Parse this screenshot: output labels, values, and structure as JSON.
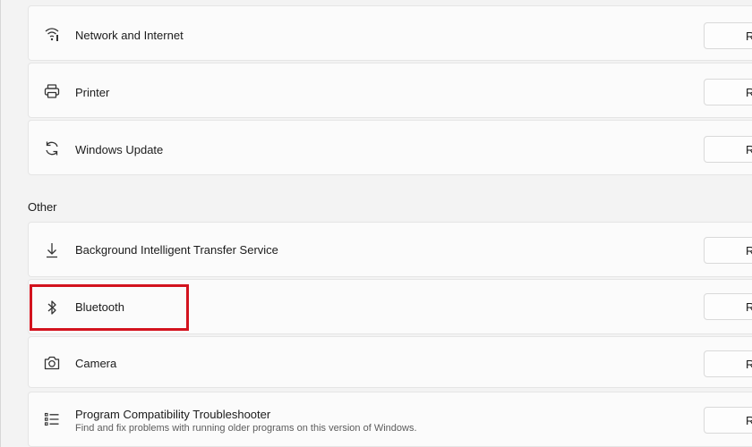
{
  "sections": {
    "other_title": "Other"
  },
  "items": [
    {
      "label": "Network and Internet",
      "icon": "wifi-icon",
      "button": "R"
    },
    {
      "label": "Printer",
      "icon": "printer-icon",
      "button": "R"
    },
    {
      "label": "Windows Update",
      "icon": "refresh-icon",
      "button": "R"
    },
    {
      "label": "Background Intelligent Transfer Service",
      "icon": "download-arrow-icon",
      "button": "R"
    },
    {
      "label": "Bluetooth",
      "icon": "bluetooth-icon",
      "button": "R"
    },
    {
      "label": "Camera",
      "icon": "camera-icon",
      "button": "R"
    },
    {
      "label": "Program Compatibility Troubleshooter",
      "sub": "Find and fix problems with running older programs on this version of Windows.",
      "icon": "list-icon",
      "button": "R"
    }
  ],
  "colors": {
    "highlight": "#d3131e",
    "card": "#fbfbfb",
    "background": "#f3f3f3"
  }
}
